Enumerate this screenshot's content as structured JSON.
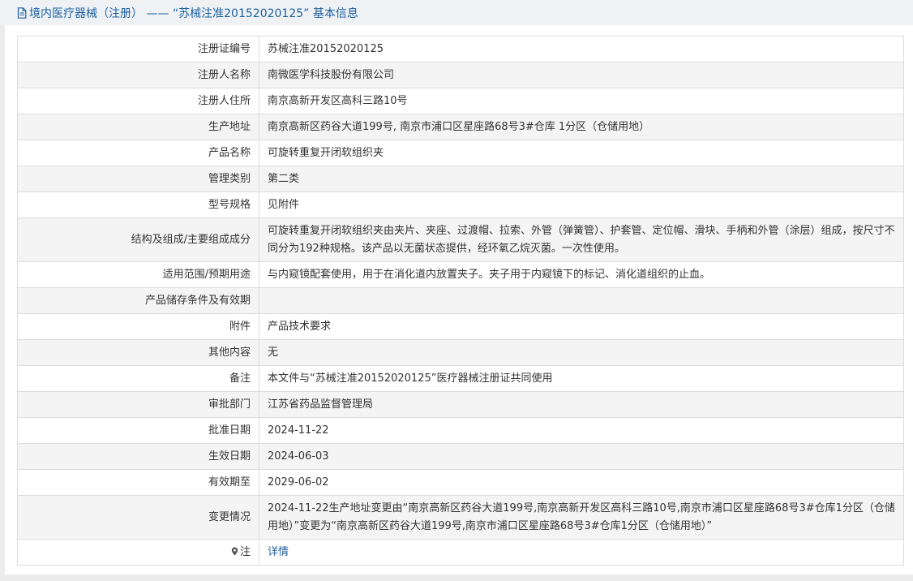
{
  "header": {
    "title": "境内医疗器械（注册） —— “苏械注准20152020125” 基本信息",
    "icon": "document-icon"
  },
  "rows": [
    {
      "label": "注册证编号",
      "value": "苏械注准20152020125"
    },
    {
      "label": "注册人名称",
      "value": "南微医学科技股份有限公司"
    },
    {
      "label": "注册人住所",
      "value": "南京高新开发区高科三路10号"
    },
    {
      "label": "生产地址",
      "value": "南京高新区药谷大道199号, 南京市浦口区星座路68号3#仓库 1分区（仓储用地）"
    },
    {
      "label": "产品名称",
      "value": "可旋转重复开闭软组织夹"
    },
    {
      "label": "管理类别",
      "value": "第二类"
    },
    {
      "label": "型号规格",
      "value": "见附件"
    },
    {
      "label": "结构及组成/主要组成成分",
      "value": "可旋转重复开闭软组织夹由夹片、夹座、过渡帽、拉索、外管（弹簧管）、护套管、定位帽、滑块、手柄和外管（涂层）组成，按尺寸不同分为192种规格。该产品以无菌状态提供，经环氧乙烷灭菌。一次性使用。"
    },
    {
      "label": "适用范围/预期用途",
      "value": "与内窥镜配套使用，用于在消化道内放置夹子。夹子用于内窥镜下的标记、消化道组织的止血。"
    },
    {
      "label": "产品储存条件及有效期",
      "value": ""
    },
    {
      "label": "附件",
      "value": "产品技术要求"
    },
    {
      "label": "其他内容",
      "value": "无"
    },
    {
      "label": "备注",
      "value": "本文件与“苏械注准20152020125”医疗器械注册证共同使用"
    },
    {
      "label": "审批部门",
      "value": "江苏省药品监督管理局"
    },
    {
      "label": "批准日期",
      "value": "2024-11-22"
    },
    {
      "label": "生效日期",
      "value": "2024-06-03"
    },
    {
      "label": "有效期至",
      "value": "2029-06-02"
    },
    {
      "label": "变更情况",
      "value": "2024-11-22生产地址变更由“南京高新区药谷大道199号,南京高新开发区高科三路10号,南京市浦口区星座路68号3#仓库1分区（仓储用地）”变更为“南京高新区药谷大道199号,南京市浦口区星座路68号3#仓库1分区（仓储用地）”"
    }
  ],
  "note": {
    "label": "注",
    "icon": "pin-icon",
    "link_text": "详情"
  },
  "colors": {
    "title": "#1f5f9f",
    "link": "#1f5f9f",
    "row_alt": "#f4f4f4",
    "border": "#dcdcdc"
  }
}
